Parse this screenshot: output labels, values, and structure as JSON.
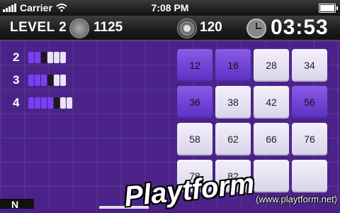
{
  "status": {
    "carrier": "Carrier",
    "time": "7:08 PM"
  },
  "hud": {
    "level": "LEVEL 2",
    "coins": "1125",
    "target": "120",
    "timer": "03:53"
  },
  "rules": [
    {
      "num": "2",
      "pattern": [
        "#7b3ff2",
        "#7b3ff2",
        "#1a1a1a",
        "#e9e3f7",
        "#e9e3f7",
        "#e9e3f7"
      ]
    },
    {
      "num": "3",
      "pattern": [
        "#7b3ff2",
        "#7b3ff2",
        "#7b3ff2",
        "#1a1a1a",
        "#e9e3f7",
        "#e9e3f7"
      ]
    },
    {
      "num": "4",
      "pattern": [
        "#7b3ff2",
        "#7b3ff2",
        "#7b3ff2",
        "#7b3ff2",
        "#1a1a1a",
        "#e9e3f7",
        "#e9e3f7"
      ]
    }
  ],
  "grid": [
    [
      {
        "v": "12",
        "s": "dark"
      },
      {
        "v": "16",
        "s": "dark"
      },
      {
        "v": "28",
        "s": "light"
      },
      {
        "v": "34",
        "s": "light"
      }
    ],
    [
      {
        "v": "36",
        "s": "dark"
      },
      {
        "v": "38",
        "s": "light"
      },
      {
        "v": "42",
        "s": "light"
      },
      {
        "v": "56",
        "s": "dark"
      }
    ],
    [
      {
        "v": "58",
        "s": "light"
      },
      {
        "v": "62",
        "s": "light"
      },
      {
        "v": "66",
        "s": "light"
      },
      {
        "v": "76",
        "s": "light"
      }
    ],
    [
      {
        "v": "78",
        "s": "light"
      },
      {
        "v": "82",
        "s": "light"
      },
      {
        "v": "",
        "s": "light"
      },
      {
        "v": "",
        "s": "light"
      }
    ]
  ],
  "watermark": {
    "brand": "Playtform",
    "sub": "(www.playtform.net)"
  },
  "corner": {
    "label": "N"
  }
}
